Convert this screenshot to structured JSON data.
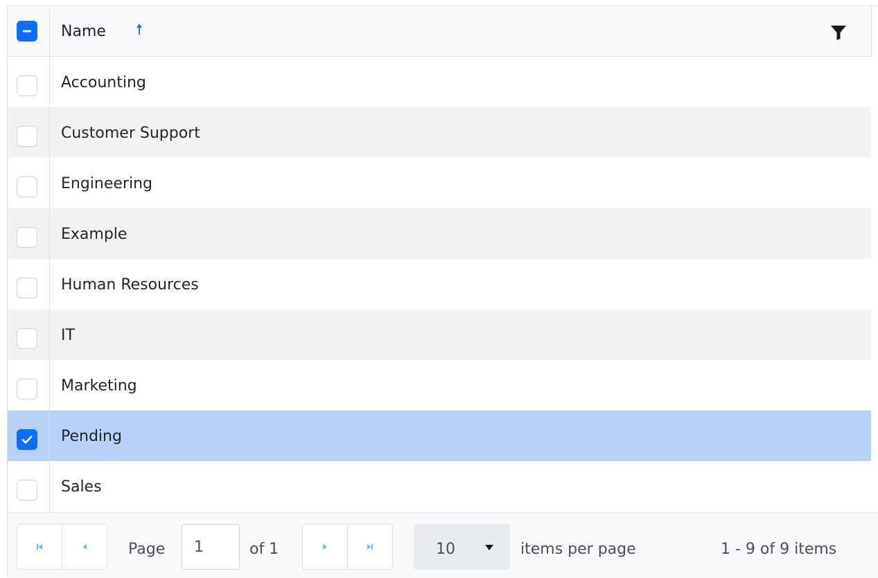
{
  "header": {
    "column_name": "Name",
    "sort_direction": "ascending",
    "select_all_state": "indeterminate"
  },
  "rows": [
    {
      "name": "Accounting",
      "checked": false
    },
    {
      "name": "Customer Support",
      "checked": false
    },
    {
      "name": "Engineering",
      "checked": false
    },
    {
      "name": "Example",
      "checked": false
    },
    {
      "name": "Human Resources",
      "checked": false
    },
    {
      "name": "IT",
      "checked": false
    },
    {
      "name": "Marketing",
      "checked": false
    },
    {
      "name": "Pending",
      "checked": true
    },
    {
      "name": "Sales",
      "checked": false
    }
  ],
  "pager": {
    "page_label": "Page",
    "current_page": "1",
    "of_label": "of 1",
    "page_size": "10",
    "items_per_page_label": "items per page",
    "summary": "1 - 9 of 9 items"
  },
  "icons": {
    "sort": "arrow-up-icon",
    "filter": "filter-icon",
    "first": "first-page-icon",
    "prev": "previous-page-icon",
    "next": "next-page-icon",
    "last": "last-page-icon",
    "dropdown": "caret-down-icon"
  },
  "colors": {
    "accent": "#0d6efd",
    "selected_row": "#b7d1f7",
    "alt_row": "#f2f2f2",
    "header_bg": "#f8f9fa",
    "sort_icon": "#2b6cde",
    "pager_icon": "#7eb3f0"
  }
}
